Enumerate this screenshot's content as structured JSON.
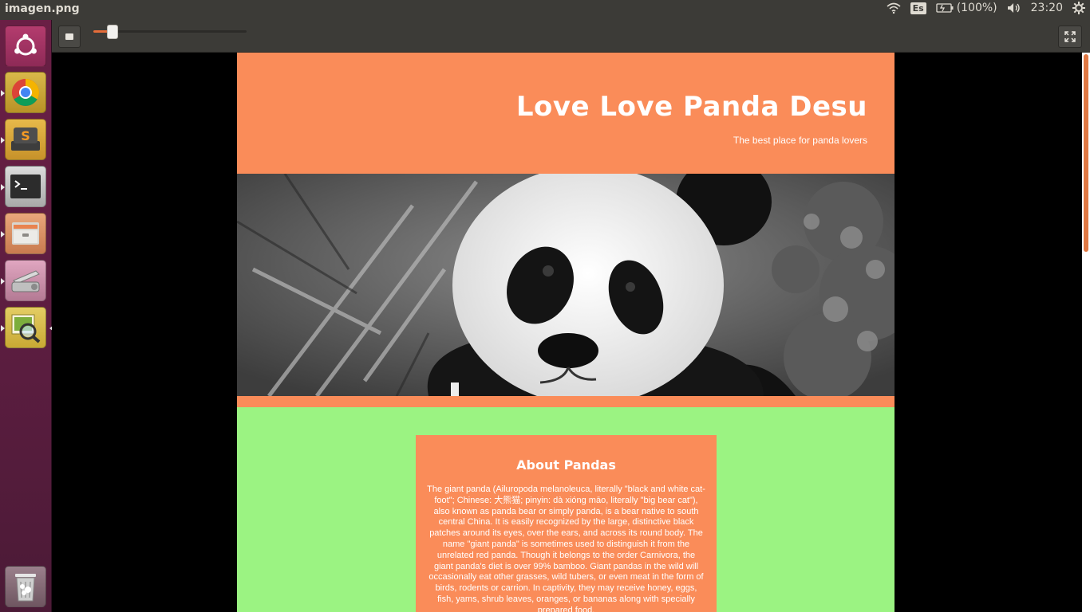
{
  "window": {
    "title": "imagen.png"
  },
  "panel": {
    "keyboard_layout": "Es",
    "battery_text": "(100%)",
    "clock": "23:20",
    "icons": [
      "wifi-icon",
      "battery-icon",
      "volume-icon",
      "settings-gear-icon"
    ]
  },
  "launcher": {
    "items": [
      {
        "name": "ubuntu-dash-icon",
        "running": false
      },
      {
        "name": "chrome-icon",
        "running": true
      },
      {
        "name": "sublime-text-icon",
        "running": true
      },
      {
        "name": "terminal-icon",
        "running": true
      },
      {
        "name": "files-icon",
        "running": true
      },
      {
        "name": "scanner-icon",
        "running": true
      },
      {
        "name": "image-viewer-icon",
        "running": true,
        "focused": true
      },
      {
        "name": "trash-icon",
        "running": false
      }
    ]
  },
  "viewer": {
    "zoom_level": 0.12
  },
  "site": {
    "title": "Love Love Panda Desu",
    "tagline": "The best place for panda lovers",
    "about": {
      "heading": "About Pandas",
      "body": "The giant panda (Ailuropoda melanoleuca, literally \"black and white cat-foot\"; Chinese: 大熊猫; pinyin: dà xióng māo, literally \"big bear cat\"), also known as panda bear or simply panda, is a bear native to south central China. It is easily recognized by the large, distinctive black patches around its eyes, over the ears, and across its round body. The name \"giant panda\" is sometimes used to distinguish it from the unrelated red panda. Though it belongs to the order Carnivora, the giant panda's diet is over 99% bamboo. Giant pandas in the wild will occasionally eat other grasses, wild tubers, or even meat in the form of birds, rodents or carrion. In captivity, they may receive honey, eggs, fish, yams, shrub leaves, oranges, or bananas along with specially prepared food."
    }
  },
  "colors": {
    "header": "#fa8c59",
    "page_background": "#9bf382",
    "launcher": "#5e1e41",
    "panel": "#3c3b37"
  }
}
